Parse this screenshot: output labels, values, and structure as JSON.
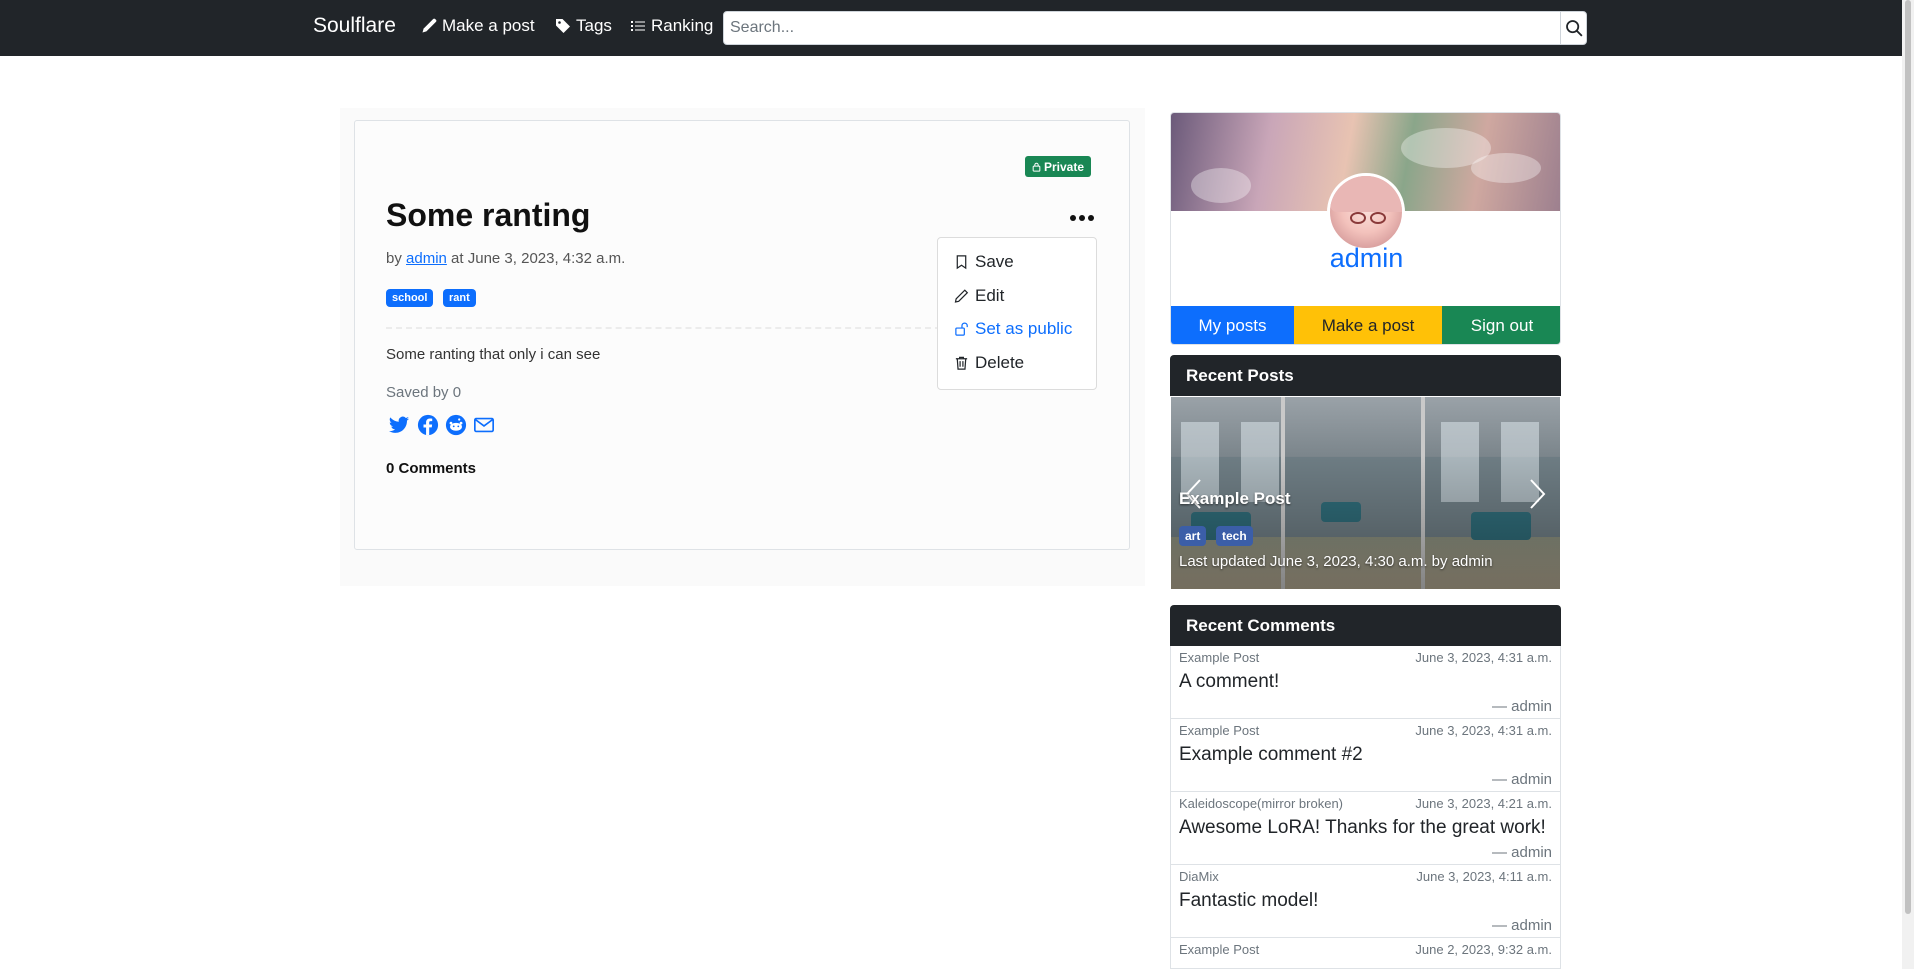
{
  "navbar": {
    "brand": "Soulflare",
    "make_post": "Make a post",
    "tags": "Tags",
    "ranking": "Ranking",
    "search_placeholder": "Search..."
  },
  "post": {
    "badge": "Private",
    "title": "Some ranting",
    "by_prefix": "by",
    "author": "admin",
    "date_text": "at June 3, 2023, 4:32 a.m.",
    "tags": [
      "school",
      "rant"
    ],
    "body": "Some ranting that only i can see",
    "saved_by": "Saved by 0",
    "share_icons": [
      "twitter-icon",
      "facebook-icon",
      "reddit-icon",
      "envelope-icon"
    ],
    "comments_count": "0 Comments"
  },
  "dropdown": {
    "items": [
      {
        "label": "Save",
        "icon": "bookmark-icon"
      },
      {
        "label": "Edit",
        "icon": "pencil-icon"
      },
      {
        "label": "Set as public",
        "icon": "unlock-icon"
      },
      {
        "label": "Delete",
        "icon": "trash-icon"
      }
    ]
  },
  "profile": {
    "name": "admin",
    "my_posts": "My posts",
    "make_post": "Make a post",
    "sign_out": "Sign out"
  },
  "recent_posts": {
    "header": "Recent Posts",
    "title": "Example Post",
    "tags": [
      "art",
      "tech"
    ],
    "meta": "Last updated June 3, 2023, 4:30 a.m. by admin"
  },
  "recent_comments": {
    "header": "Recent Comments",
    "items": [
      {
        "post": "Example Post",
        "date": "June 3, 2023, 4:31 a.m.",
        "text": "A comment!",
        "author": "— admin"
      },
      {
        "post": "Example Post",
        "date": "June 3, 2023, 4:31 a.m.",
        "text": "Example comment #2",
        "author": "— admin"
      },
      {
        "post": "Kaleidoscope(mirror broken)",
        "date": "June 3, 2023, 4:21 a.m.",
        "text": "Awesome LoRA! Thanks for the great work!",
        "author": "— admin"
      },
      {
        "post": "DiaMix",
        "date": "June 3, 2023, 4:11 a.m.",
        "text": "Fantastic model!",
        "author": "— admin"
      },
      {
        "post": "Example Post",
        "date": "June 2, 2023, 9:32 a.m.",
        "text": "",
        "author": ""
      }
    ]
  },
  "colors": {
    "navbar": "#212529",
    "primary": "#0d6efd",
    "warning": "#ffc107",
    "success": "#198754"
  }
}
